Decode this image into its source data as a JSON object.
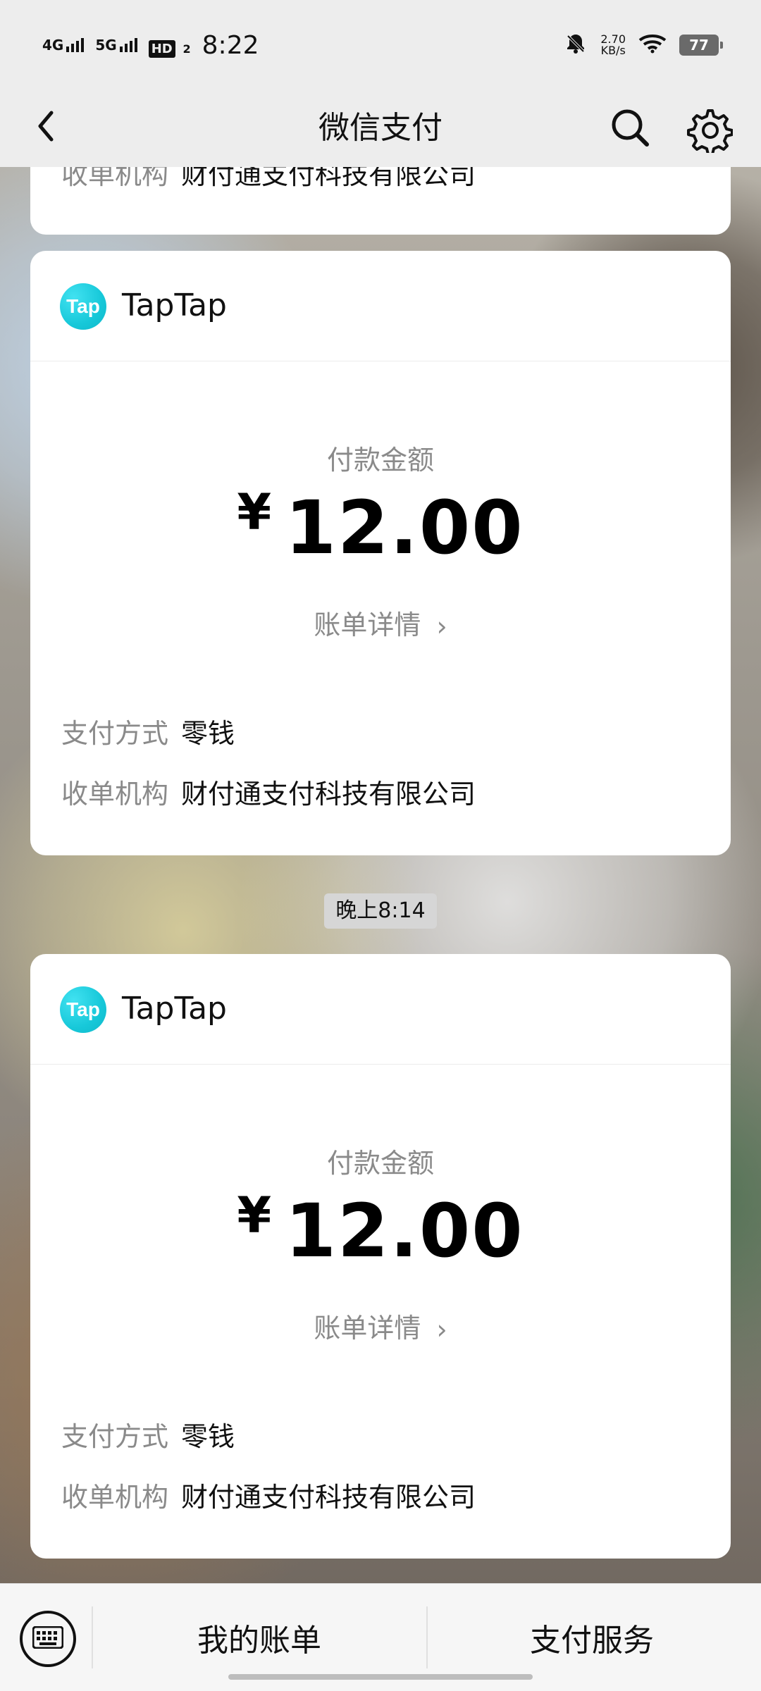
{
  "status_bar": {
    "network1": "4G",
    "network2": "5G",
    "hd_label": "HD",
    "hd_sub": "2",
    "time": "8:22",
    "net_speed_value": "2.70",
    "net_speed_unit": "KB/s",
    "battery": "77"
  },
  "nav": {
    "title": "微信支付",
    "icons": [
      "back-icon",
      "search-icon",
      "gear-icon"
    ]
  },
  "top_partial_card": {
    "label": "收单机构",
    "value": "财付通支付科技有限公司"
  },
  "cards": [
    {
      "merchant": "TapTap",
      "logo_text": "Tap",
      "amount_label": "付款金额",
      "currency": "¥",
      "amount": "12.00",
      "detail_link": "账单详情",
      "detail_chevron": "›",
      "pay_method_label": "支付方式",
      "pay_method_value": "零钱",
      "acquirer_label": "收单机构",
      "acquirer_value": "财付通支付科技有限公司"
    },
    {
      "merchant": "TapTap",
      "logo_text": "Tap",
      "amount_label": "付款金额",
      "currency": "¥",
      "amount": "12.00",
      "detail_link": "账单详情",
      "detail_chevron": "›",
      "pay_method_label": "支付方式",
      "pay_method_value": "零钱",
      "acquirer_label": "收单机构",
      "acquirer_value": "财付通支付科技有限公司"
    }
  ],
  "time_divider": "晚上8:14",
  "bottom_bar": {
    "tab_bill": "我的账单",
    "tab_service": "支付服务"
  },
  "colors": {
    "accent_teal": "#17c8d9",
    "text_primary": "#111111",
    "text_secondary": "#8a8a8a"
  }
}
